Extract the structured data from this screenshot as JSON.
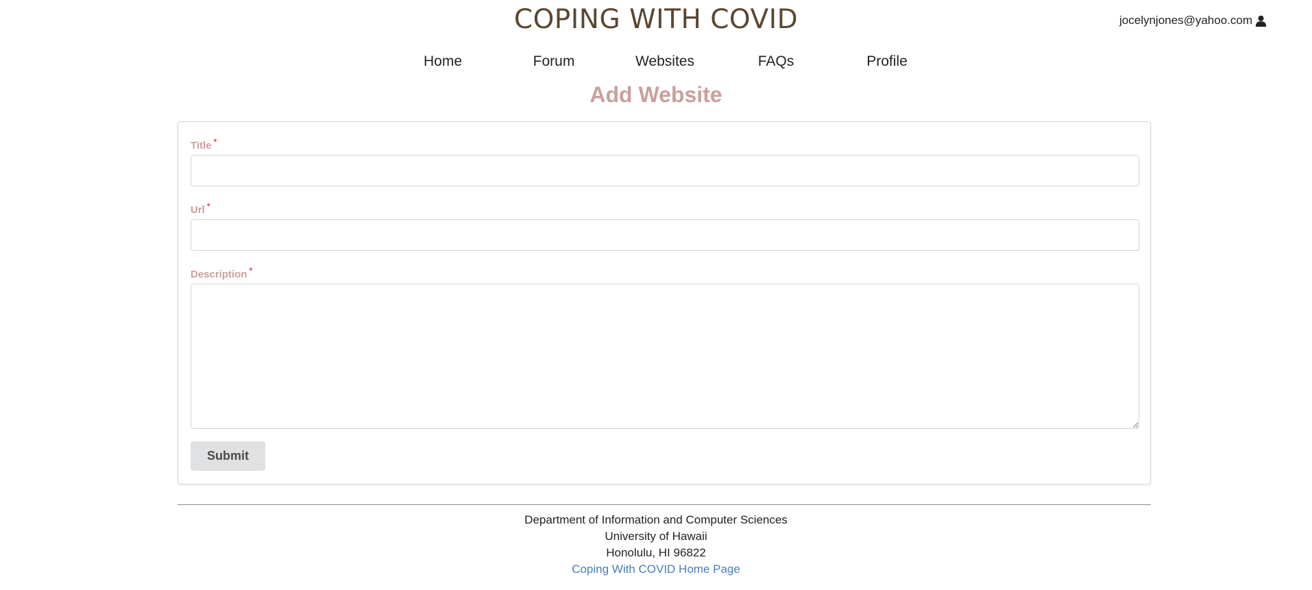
{
  "header": {
    "site_title": "COPING WITH COVID",
    "user_email": "jocelynjones@yahoo.com",
    "user_icon": "user-icon"
  },
  "nav": {
    "items": [
      {
        "label": "Home"
      },
      {
        "label": "Forum"
      },
      {
        "label": "Websites"
      },
      {
        "label": "FAQs"
      },
      {
        "label": "Profile"
      }
    ]
  },
  "main": {
    "heading": "Add Website",
    "form": {
      "title_label": "Title",
      "title_value": "",
      "url_label": "Url",
      "url_value": "",
      "description_label": "Description",
      "description_value": "",
      "required_marker": "*",
      "submit_label": "Submit"
    }
  },
  "footer": {
    "line1": "Department of Information and Computer Sciences",
    "line2": "University of Hawaii",
    "line3": "Honolulu, HI 96822",
    "link_text": "Coping With COVID Home Page"
  },
  "colors": {
    "title_brown": "#5a4632",
    "accent_pink": "#c9a09b",
    "required_red": "#d05050",
    "link_blue": "#4a7cb8",
    "button_gray": "#e0e1e2"
  }
}
